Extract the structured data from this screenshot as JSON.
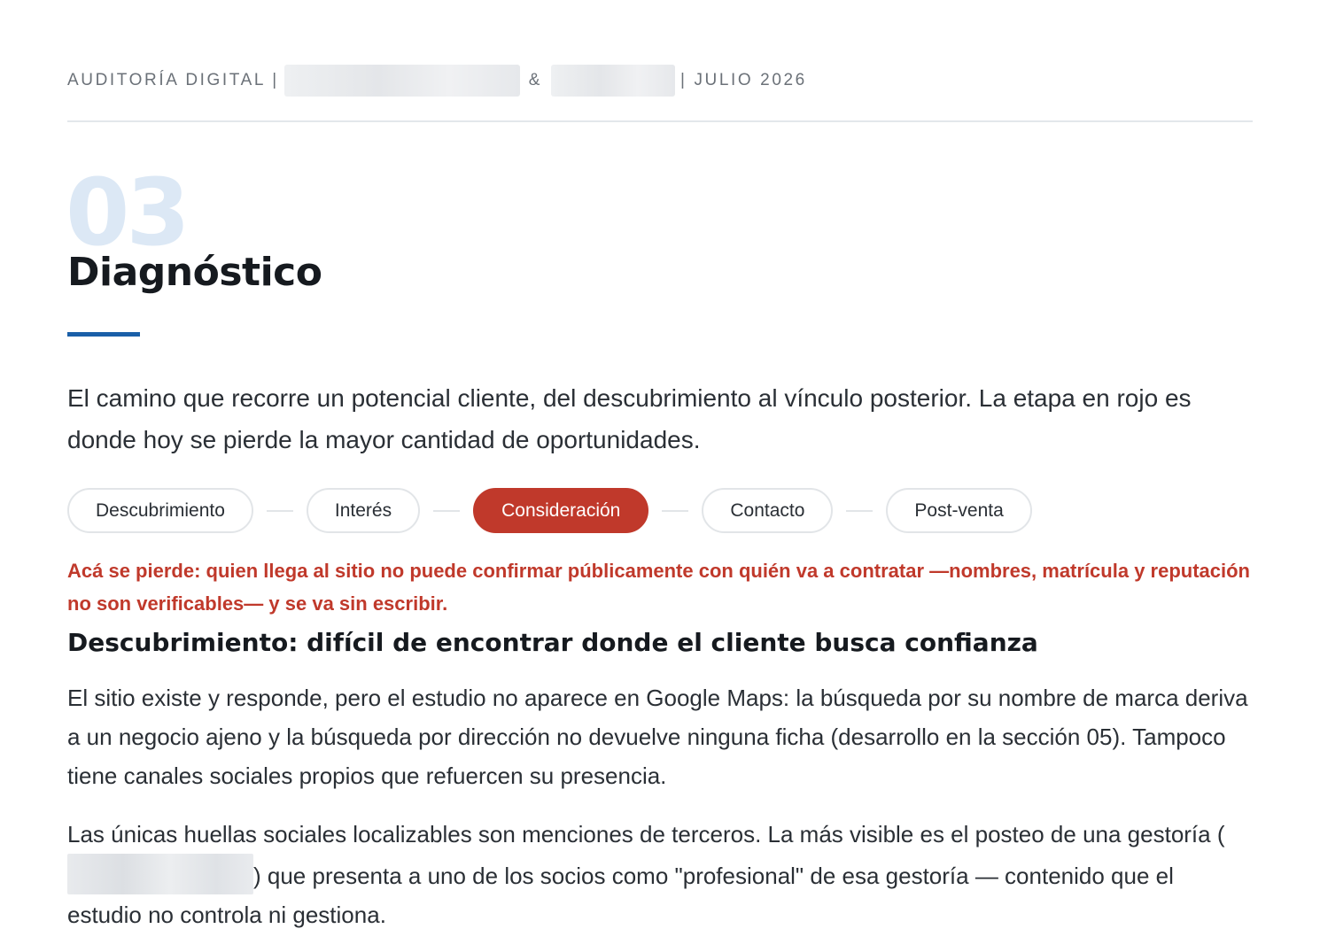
{
  "header": {
    "prefix": "AUDITORÍA DIGITAL |",
    "ampersand": "&",
    "suffix": "| JULIO 2026"
  },
  "section": {
    "number": "03",
    "title": "Diagnóstico"
  },
  "intro": "El camino que recorre un potencial cliente, del descubrimiento al vínculo posterior. La etapa en rojo es donde hoy se pierde la mayor cantidad de oportunidades.",
  "stepper": {
    "steps": [
      {
        "label": "Descubrimiento",
        "active": false
      },
      {
        "label": "Interés",
        "active": false
      },
      {
        "label": "Consideración",
        "active": true
      },
      {
        "label": "Contacto",
        "active": false
      },
      {
        "label": "Post-venta",
        "active": false
      }
    ],
    "active_color": "#c0392b"
  },
  "warning": "Acá se pierde: quien llega al sitio no puede confirmar públicamente con quién va a contratar —nombres, matrícula y reputación no son verificables— y se va sin escribir.",
  "subheading": "Descubrimiento: difícil de encontrar donde el cliente busca confianza",
  "paragraphs": {
    "p1": "El sitio existe y responde, pero el estudio no aparece en Google Maps: la búsqueda por su nombre de marca deriva a un negocio ajeno y la búsqueda por dirección no devuelve ninguna ficha (desarrollo en la sección 05). Tampoco tiene canales sociales propios que refuercen su presencia.",
    "p2_before": "Las únicas huellas sociales localizables son menciones de terceros. La más visible es el posteo de una gestoría (",
    "p2_after": ") que presenta a uno de los socios como \"profesional\" de esa gestoría — contenido que el estudio no controla ni gestiona."
  },
  "colors": {
    "accent_blue": "#1a5fa8",
    "alert_red": "#c0392b",
    "number_tint": "#dce8f5"
  }
}
